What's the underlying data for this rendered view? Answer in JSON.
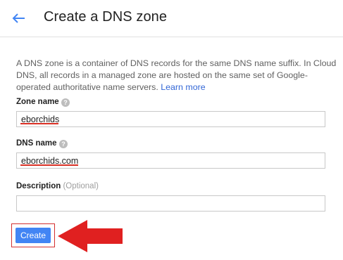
{
  "header": {
    "title": "Create a DNS zone"
  },
  "description": {
    "text": "A DNS zone is a container of DNS records for the same DNS name suffix. In Cloud DNS, all records in a managed zone are hosted on the same set of Google-operated authoritative name servers. ",
    "link_label": "Learn more"
  },
  "form": {
    "zone_name": {
      "label": "Zone name",
      "value": "eborchids"
    },
    "dns_name": {
      "label": "DNS name",
      "value": "eborchids.com"
    },
    "description": {
      "label": "Description",
      "optional": "(Optional)",
      "value": ""
    }
  },
  "actions": {
    "create_label": "Create"
  },
  "colors": {
    "accent": "#4285f4",
    "link": "#3367d6",
    "highlight": "#d32f2f",
    "arrow": "#e02020"
  },
  "icons": {
    "back": "arrow-left-icon",
    "help": "help-circle-icon",
    "annotation": "red-arrow-left-icon"
  }
}
